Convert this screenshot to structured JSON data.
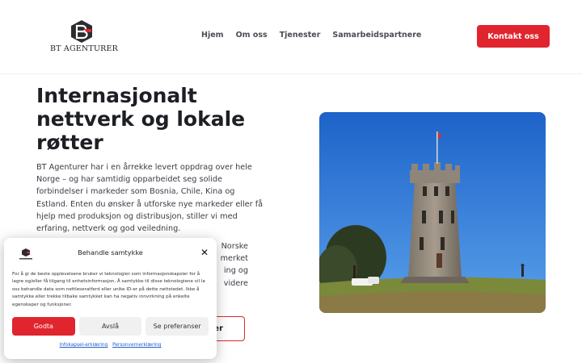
{
  "header": {
    "logo_text": "BT AGENTURER",
    "nav": [
      "Hjem",
      "Om oss",
      "Tjenester",
      "Samarbeidspartnere"
    ],
    "cta_label": "Kontakt oss"
  },
  "hero": {
    "title": "Internasjonalt nettverk og lokale røtter",
    "paragraph1": "BT Agenturer har i en årrekke levert oppdrag over hele Norge – og har samtidig opparbeidet seg solide forbindelser i markeder som Bosnia, Chile, Kina og Estland. Enten du ønsker å utforske nye markeder eller få hjelp med produksjon og distribusjon, stiller vi med erfaring, nettverk og god veiledning.",
    "paragraph2_lines": [
      "Norske",
      "merket",
      "ing og",
      "videre"
    ],
    "button_label": "er"
  },
  "cookie": {
    "title": "Behandle samtykke",
    "close_glyph": "✕",
    "text": "For å gi de beste opplevelsene bruker vi teknologier som informasjonskapsler for å lagre og/eller få tilgang til enhetsinformasjon. Å samtykke til disse teknologiene vil la oss behandle data som nettleseratferd eller unike ID-er på dette nettstedet. Ikke å samtykke eller trekke tilbake samtykket kan ha negativ innvirkning på enkelte egenskaper og funksjoner.",
    "accept_label": "Godta",
    "deny_label": "Avslå",
    "prefs_label": "Se preferanser",
    "link1": "Infokapsel-erklæring",
    "link2": "Personvernerklæring"
  },
  "colors": {
    "accent": "#e1252f",
    "logo_dark": "#2b2b30",
    "sky": "#2a78dc",
    "grass": "#7a8a3a"
  }
}
